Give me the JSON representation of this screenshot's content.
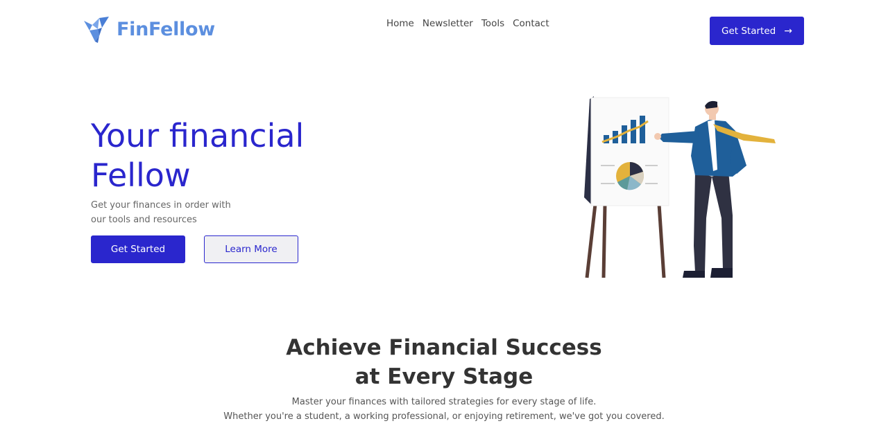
{
  "brand": {
    "name": "FinFellow",
    "color": "#5c8fdf"
  },
  "nav": {
    "items": [
      "Home",
      "Newsletter",
      "Tools",
      "Contact"
    ]
  },
  "header": {
    "cta_label": "Get Started",
    "cta_icon": "arrow-right-icon",
    "cta_color": "#2a26cd"
  },
  "hero": {
    "title_line1": "Your financial",
    "title_line2": "Fellow",
    "subtitle_line1": "Get your finances in order with",
    "subtitle_line2": "our tools and resources",
    "primary_label": "Get Started",
    "secondary_label": "Learn More",
    "illustration": "presenter-with-chart-illustration"
  },
  "section": {
    "title_line1": "Achieve Financial Success",
    "title_line2": "at Every Stage",
    "body_line1": "Master your finances with tailored strategies for every stage of life.",
    "body_line2": "Whether you're a student, a working professional, or enjoying retirement, we've got you covered."
  }
}
